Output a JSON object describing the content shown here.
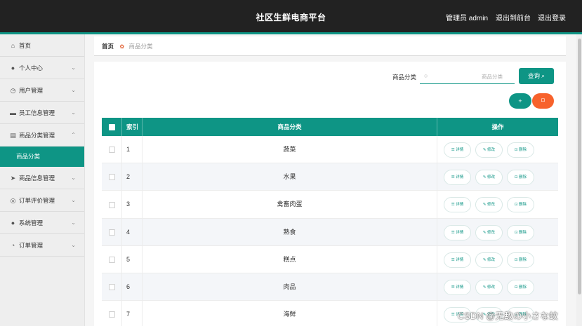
{
  "header": {
    "title": "社区生鲜电商平台",
    "user_label": "管理员 admin",
    "to_frontend": "退出到前台",
    "logout": "退出登录"
  },
  "sidebar": {
    "items": [
      {
        "label": "首页",
        "icon": "home-icon",
        "glyph": "⌂",
        "chevron": ""
      },
      {
        "label": "个人中心",
        "icon": "person-icon",
        "glyph": "●",
        "chevron": "⌄"
      },
      {
        "label": "用户管理",
        "icon": "clock-icon",
        "glyph": "◷",
        "chevron": "⌄"
      },
      {
        "label": "员工信息管理",
        "icon": "monitor-icon",
        "glyph": "▬",
        "chevron": "⌄"
      },
      {
        "label": "商品分类管理",
        "icon": "list-icon",
        "glyph": "▤",
        "chevron": "⌃"
      },
      {
        "label": "商品信息管理",
        "icon": "send-icon",
        "glyph": "➤",
        "chevron": "⌄"
      },
      {
        "label": "订单评价管理",
        "icon": "globe-icon",
        "glyph": "◎",
        "chevron": "⌄"
      },
      {
        "label": "系统管理",
        "icon": "pin-icon",
        "glyph": "●",
        "chevron": "⌄"
      },
      {
        "label": "订单管理",
        "icon": "dial-icon",
        "glyph": "◔",
        "chevron": "⌄"
      }
    ],
    "active_sub": "商品分类"
  },
  "breadcrumb": {
    "home": "首页",
    "separator_icon": "flower-icon",
    "separator_glyph": "✿",
    "current": "商品分类"
  },
  "search": {
    "label": "商品分类",
    "placeholder": "商品分类",
    "icon": "search-icon",
    "button": "查询 ⌕"
  },
  "actions": {
    "add": "+",
    "delete": "⊡"
  },
  "table": {
    "headers": {
      "index": "索引",
      "category": "商品分类",
      "ops": "操作"
    },
    "ops": {
      "detail": "☰ 详情",
      "edit": "✎ 修改",
      "remove": "⊡ 删除"
    },
    "rows": [
      {
        "index": "1",
        "category": "蔬菜"
      },
      {
        "index": "2",
        "category": "水果"
      },
      {
        "index": "3",
        "category": "禽畜肉蛋"
      },
      {
        "index": "4",
        "category": "熟食"
      },
      {
        "index": "5",
        "category": "糕点"
      },
      {
        "index": "6",
        "category": "肉品"
      },
      {
        "index": "7",
        "category": "海鲜"
      }
    ]
  },
  "watermark": "CSDN @无敌の小さな蚊",
  "colors": {
    "accent": "#0e9585",
    "danger": "#f7622c",
    "topbar": "#222222"
  }
}
